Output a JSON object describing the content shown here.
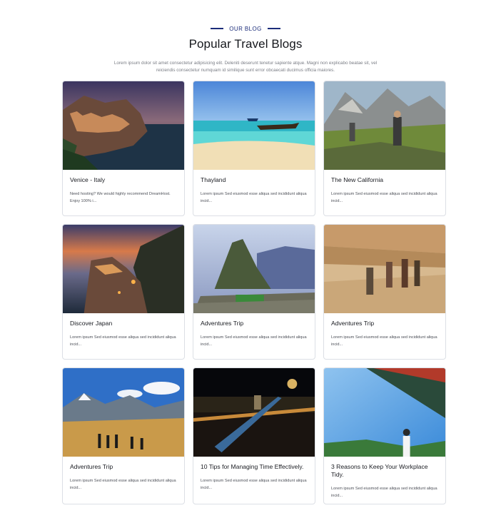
{
  "header": {
    "eyebrow": "OUR BLOG",
    "title": "Popular Travel Blogs",
    "subtitle": "Lorem ipsum dolor sit amet consectetur adipisicing elit. Deleniti deserunt tenetur sapiente atque. Magni non explicabo beatae sit, vel reiciendis consectetur numquam id similique sunt error obcaecati ducimus officia maiores."
  },
  "cards": [
    {
      "title": "Venice - Italy",
      "text": "Need hosting? We would highly recommend DreamHost. Enjoy 100% i..."
    },
    {
      "title": "Thayland",
      "text": "Lorem ipsum Sed eiusmod esse aliqua sed incididunt aliqua incid..."
    },
    {
      "title": "The New California",
      "text": "Lorem ipsum Sed eiusmod esse aliqua sed incididunt aliqua incid..."
    },
    {
      "title": "Discover Japan",
      "text": "Lorem ipsum Sed eiusmod esse aliqua sed incididunt aliqua incid..."
    },
    {
      "title": "Adventures Trip",
      "text": "Lorem ipsum Sed eiusmod esse aliqua sed incididunt aliqua incid..."
    },
    {
      "title": "Adventures Trip",
      "text": "Lorem ipsum Sed eiusmod esse aliqua sed incididunt aliqua incid..."
    },
    {
      "title": "Adventures Trip",
      "text": "Lorem ipsum Sed eiusmod esse aliqua sed incididunt aliqua incid..."
    },
    {
      "title": "10 Tips for Managing Time Effectively.",
      "text": "Lorem ipsum Sed eiusmod esse aliqua sed incididunt aliqua incid..."
    },
    {
      "title": "3 Reasons to Keep Your Workplace Tidy.",
      "text": "Lorem ipsum Sed eiusmod esse aliqua sed incididunt aliqua incid..."
    }
  ],
  "colors": {
    "accent": "#1b2c7a",
    "border": "#dcdfe5"
  }
}
